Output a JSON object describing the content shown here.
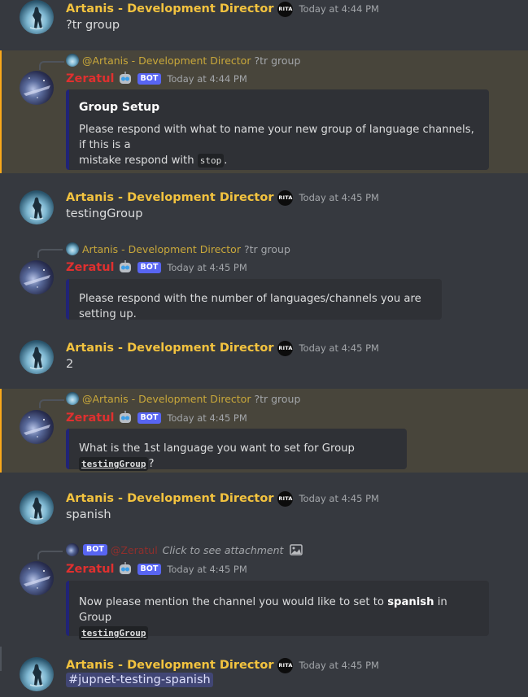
{
  "users": {
    "artanis": "Artanis - Development Director",
    "artanis_mention": "@Artanis - Development Director",
    "zeratul": "Zeratul",
    "zeratul_mention": "@Zeratul",
    "rita_badge": "RITA",
    "bot_tag": "BOT"
  },
  "messages": [
    {
      "time": "Today at 4:44 PM",
      "text": "?tr group"
    },
    {
      "reply_text": "?tr group",
      "time": "Today at 4:44 PM",
      "embed_title": "Group Setup",
      "embed_desc_a": "Please respond with what to name your new group of language channels, if this is a",
      "embed_desc_b": "mistake respond with",
      "embed_code": "stop",
      "embed_tail": "."
    },
    {
      "time": "Today at 4:45 PM",
      "text": "testingGroup"
    },
    {
      "reply_text": "?tr group",
      "time": "Today at 4:45 PM",
      "embed_desc": "Please respond with the number of languages/channels you are setting up."
    },
    {
      "time": "Today at 4:45 PM",
      "text": "2"
    },
    {
      "reply_text": "?tr group",
      "time": "Today at 4:45 PM",
      "embed_desc_a": "What is the 1st language you want to set for Group",
      "embed_code": "testingGroup",
      "embed_tail": "?"
    },
    {
      "time": "Today at 4:45 PM",
      "text": "spanish"
    },
    {
      "reply_text": "Click to see attachment",
      "time": "Today at 4:45 PM",
      "embed_desc_a": "Now please mention the channel you would like to set to",
      "embed_bold": "spanish",
      "embed_desc_b": "in Group",
      "embed_code": "testingGroup"
    },
    {
      "time": "Today at 4:45 PM",
      "text": "#jupnet-testing-spanish"
    }
  ],
  "colors": {
    "background": "#36393f",
    "highlight": "#48453b",
    "artanis_name": "#f3c33f",
    "zeratul_name": "#e0302f",
    "embed_bg": "#2f3136",
    "embed_border": "#202377",
    "bot_tag": "#5865f2"
  }
}
